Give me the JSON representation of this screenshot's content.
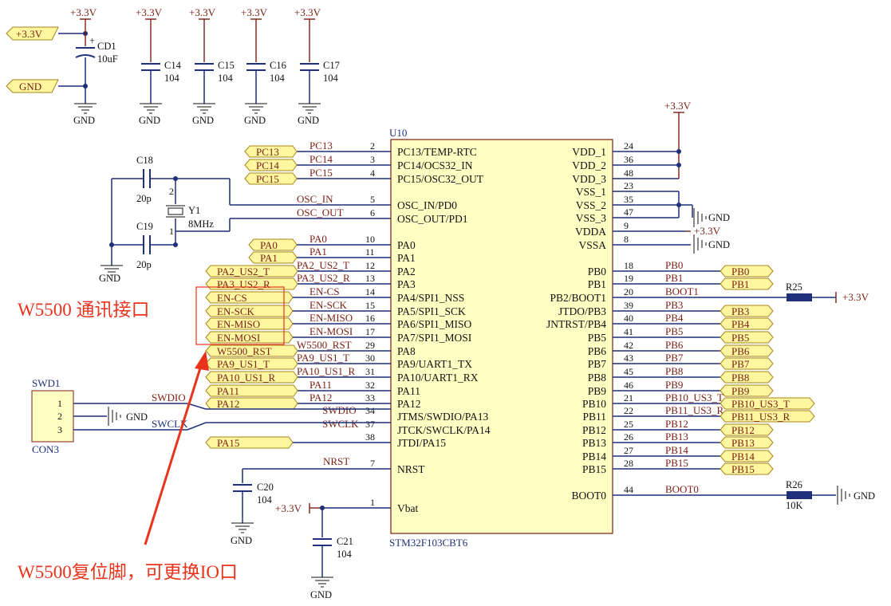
{
  "power_labels": {
    "vcc": "+3.3V",
    "gnd": "GND"
  },
  "components": {
    "cd1": {
      "ref": "CD1",
      "value": "10uF"
    },
    "c14": {
      "ref": "C14",
      "value": "104"
    },
    "c15": {
      "ref": "C15",
      "value": "104"
    },
    "c16": {
      "ref": "C16",
      "value": "104"
    },
    "c17": {
      "ref": "C17",
      "value": "104"
    },
    "c18": {
      "ref": "C18",
      "value": "20p"
    },
    "c19": {
      "ref": "C19",
      "value": "20p"
    },
    "c20": {
      "ref": "C20",
      "value": "104"
    },
    "c21": {
      "ref": "C21",
      "value": "104"
    },
    "y1": {
      "ref": "Y1",
      "value": "8MHz",
      "pin1": "1",
      "pin2": "2"
    },
    "r25": {
      "ref": "R25",
      "value": ""
    },
    "r26": {
      "ref": "R26",
      "value": "10K"
    },
    "swd1": {
      "ref": "SWD1",
      "value": "CON3",
      "pins": [
        "1",
        "2",
        "3"
      ],
      "nets": [
        "SWDIO",
        "",
        "SWCLK"
      ]
    }
  },
  "mcu": {
    "ref": "U10",
    "part": "STM32F103CBT6",
    "left_pins": [
      {
        "num": "2",
        "name": "PC13/TEMP-RTC",
        "net": "PC13",
        "flag": "PC13"
      },
      {
        "num": "3",
        "name": "PC14/OCS32_IN",
        "net": "PC14",
        "flag": "PC14"
      },
      {
        "num": "4",
        "name": "PC15/OSC32_OUT",
        "net": "PC15",
        "flag": "PC15"
      },
      {
        "num": "5",
        "name": "OSC_IN/PD0",
        "net": "OSC_IN",
        "flag": ""
      },
      {
        "num": "6",
        "name": "OSC_OUT/PD1",
        "net": "OSC_OUT",
        "flag": ""
      },
      {
        "num": "10",
        "name": "PA0",
        "net": "PA0",
        "flag": "PA0"
      },
      {
        "num": "11",
        "name": "PA1",
        "net": "PA1",
        "flag": "PA1"
      },
      {
        "num": "12",
        "name": "PA2",
        "net": "PA2_US2_T",
        "flag": "PA2_US2_T"
      },
      {
        "num": "13",
        "name": "PA3",
        "net": "PA3_US2_R",
        "flag": "PA3_US2_R"
      },
      {
        "num": "14",
        "name": "PA4/SPI1_NSS",
        "net": "EN-CS",
        "flag": "EN-CS"
      },
      {
        "num": "15",
        "name": "PA5/SPI1_SCK",
        "net": "EN-SCK",
        "flag": "EN-SCK"
      },
      {
        "num": "16",
        "name": "PA6/SPI1_MISO",
        "net": "EN-MISO",
        "flag": "EN-MISO"
      },
      {
        "num": "17",
        "name": "PA7/SPI1_MOSI",
        "net": "EN-MOSI",
        "flag": "EN-MOSI"
      },
      {
        "num": "29",
        "name": "PA8",
        "net": "W5500_RST",
        "flag": "W5500_RST"
      },
      {
        "num": "30",
        "name": "PA9/UART1_TX",
        "net": "PA9_US1_T",
        "flag": "PA9_US1_T"
      },
      {
        "num": "31",
        "name": "PA10/UART1_RX",
        "net": "PA10_US1_R",
        "flag": "PA10_US1_R"
      },
      {
        "num": "32",
        "name": "PA11",
        "net": "PA11",
        "flag": "PA11"
      },
      {
        "num": "33",
        "name": "PA12",
        "net": "PA12",
        "flag": "PA12"
      },
      {
        "num": "34",
        "name": "JTMS/SWDIO/PA13",
        "net": "SWDIO",
        "flag": ""
      },
      {
        "num": "37",
        "name": "JTCK/SWCLK/PA14",
        "net": "SWCLK",
        "flag": ""
      },
      {
        "num": "38",
        "name": "JTDI/PA15",
        "net": "",
        "flag": "PA15"
      },
      {
        "num": "7",
        "name": "NRST",
        "net": "NRST",
        "flag": ""
      },
      {
        "num": "1",
        "name": "Vbat",
        "net": "",
        "flag": ""
      }
    ],
    "right_pins": [
      {
        "num": "24",
        "name": "VDD_1",
        "net": "",
        "flag": ""
      },
      {
        "num": "36",
        "name": "VDD_2",
        "net": "",
        "flag": ""
      },
      {
        "num": "48",
        "name": "VDD_3",
        "net": "",
        "flag": ""
      },
      {
        "num": "23",
        "name": "VSS_1",
        "net": "",
        "flag": ""
      },
      {
        "num": "35",
        "name": "VSS_2",
        "net": "",
        "flag": ""
      },
      {
        "num": "47",
        "name": "VSS_3",
        "net": "",
        "flag": ""
      },
      {
        "num": "9",
        "name": "VDDA",
        "net": "",
        "flag": ""
      },
      {
        "num": "8",
        "name": "VSSA",
        "net": "",
        "flag": ""
      },
      {
        "num": "18",
        "name": "PB0",
        "net": "PB0",
        "flag": "PB0"
      },
      {
        "num": "19",
        "name": "PB1",
        "net": "PB1",
        "flag": "PB1"
      },
      {
        "num": "20",
        "name": "PB2/BOOT1",
        "net": "BOOT1",
        "flag": ""
      },
      {
        "num": "39",
        "name": "JTDO/PB3",
        "net": "PB3",
        "flag": "PB3"
      },
      {
        "num": "40",
        "name": "JNTRST/PB4",
        "net": "PB4",
        "flag": "PB4"
      },
      {
        "num": "41",
        "name": "PB5",
        "net": "PB5",
        "flag": "PB5"
      },
      {
        "num": "42",
        "name": "PB6",
        "net": "PB6",
        "flag": "PB6"
      },
      {
        "num": "43",
        "name": "PB7",
        "net": "PB7",
        "flag": "PB7"
      },
      {
        "num": "45",
        "name": "PB8",
        "net": "PB8",
        "flag": "PB8"
      },
      {
        "num": "46",
        "name": "PB9",
        "net": "PB9",
        "flag": "PB9"
      },
      {
        "num": "21",
        "name": "PB10",
        "net": "PB10_US3_T",
        "flag": "PB10_US3_T"
      },
      {
        "num": "22",
        "name": "PB11",
        "net": "PB11_US3_R",
        "flag": "PB11_US3_R"
      },
      {
        "num": "25",
        "name": "PB12",
        "net": "PB12",
        "flag": "PB12"
      },
      {
        "num": "26",
        "name": "PB13",
        "net": "PB13",
        "flag": "PB13"
      },
      {
        "num": "27",
        "name": "PB14",
        "net": "PB14",
        "flag": "PB14"
      },
      {
        "num": "28",
        "name": "PB15",
        "net": "PB15",
        "flag": "PB15"
      },
      {
        "num": "44",
        "name": "BOOT0",
        "net": "BOOT0",
        "flag": ""
      }
    ]
  },
  "annotations": {
    "w5500_interface": "W5500 通讯接口",
    "w5500_reset": "W5500复位脚，可更换IO口"
  },
  "colors": {
    "wire": "#1f2f7a",
    "net_text": "#7b1e14",
    "flag_fill": "#fff6a0",
    "annotation": "#e8341c"
  }
}
